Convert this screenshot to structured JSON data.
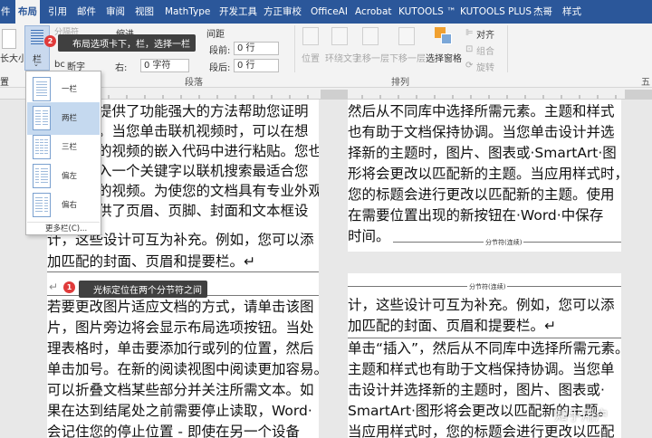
{
  "ribbon": {
    "tabs": [
      "件",
      "布局",
      "引用",
      "邮件",
      "审阅",
      "视图",
      "MathType",
      "开发工具",
      "方正审校",
      "OfficeAI",
      "Acrobat",
      "KUTOOLS ™",
      "KUTOOLS PLUS",
      "杰哥",
      "样式"
    ],
    "active_tab": "布局",
    "left_cut_label": "长大小",
    "columns_button_label": "栏",
    "hyphenation_label": "断字",
    "top_cut_label": "分隔符",
    "indent_label": "缩进",
    "spacing_label": "间距",
    "indent_right_label": "右:",
    "indent_right_value": "0 字符",
    "spacing_before_label": "段前:",
    "spacing_before_value": "0 行",
    "spacing_after_label": "段后:",
    "spacing_after_value": "0 行",
    "paragraph_group_label": "段落",
    "arrange_group_label": "排列",
    "position_label": "位置",
    "wrap_label": "环绕文字",
    "bring_forward_label": "上移一层",
    "send_backward_label": "下移一层",
    "selection_pane_label": "选择窗格",
    "align_label": "对齐",
    "group_label": "组合",
    "rotate_label": "旋转",
    "left_group_label": "置",
    "page_group_cut": "五"
  },
  "columns_menu": {
    "items": [
      "一栏",
      "两栏",
      "三栏",
      "偏左",
      "偏右"
    ],
    "selected": "两栏",
    "more": "更多栏(C)..."
  },
  "callouts": {
    "step1_number": "1",
    "step1_text": "光标定位在两个分节符之间",
    "step2_number": "2",
    "step2_text": "布局选项卡下，栏，选择一栏"
  },
  "document": {
    "page1_top_lines": [
      "提供了功能强大的方法帮助您证明",
      "。当您单击联机视频时，可以在想",
      "的视频的嵌入代码中进行粘贴。您也",
      "入一个关键字以联机搜索最适合您",
      "的视频。为使您的文档具有专业外观，",
      "供了页眉、页脚、封面和文本框设",
      "计，这些设计可互为补充。例如，您可以添",
      "加匹配的封面、页眉和提要栏。↵"
    ],
    "cursor_line": "↵",
    "page1_bottom_lines": [
      "若要更改图片适应文档的方式，请单击该图",
      "片，图片旁边将会显示布局选项按钮。当处",
      "理表格时，单击要添加行或列的位置，然后",
      "单击加号。在新的阅读视图中阅读更加容易。",
      "可以折叠文档某些部分并关注所需文本。如",
      "果在达到结尾处之前需要停止读取，Word·",
      "会记住您的停止位置 - 即使在另一个设备"
    ],
    "right_top_lines": [
      "然后从不同库中选择所需元素。主题和样式",
      "也有助于文档保持协调。当您单击设计并选",
      "择新的主题时，图片、图表或·SmartArt·图",
      "形将会更改以匹配新的主题。当应用样式时，",
      "您的标题会进行更改以匹配新的主题。使用",
      "在需要位置出现的新按钮在·Word·中保存",
      "时间。"
    ],
    "section_break_label": "分节符(连续)",
    "right_bottom_lines": [
      "计，这些设计可互为补充。例如，您可以添",
      "加匹配的封面、页眉和提要栏。↵",
      "单击“插入”，然后从不同库中选择所需元素。",
      "主题和样式也有助于文档保持协调。当您单",
      "击设计并选择新的主题时，图片、图表或·",
      "SmartArt·图形将会更改以匹配新的主题。",
      "当应用样式时，您的标题会进行更改以匹配"
    ]
  },
  "watermark": "知乎用户"
}
